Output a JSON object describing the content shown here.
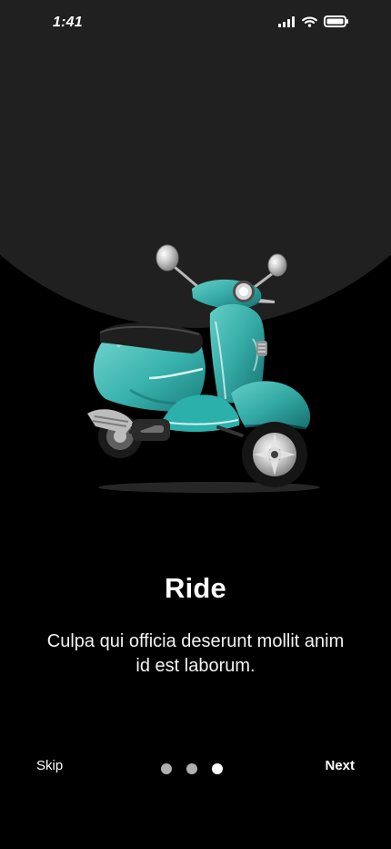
{
  "status_bar": {
    "time": "1:41",
    "icons": [
      "signal-icon",
      "wifi-icon",
      "battery-icon"
    ]
  },
  "hero": {
    "image_label": "scooter-image"
  },
  "content": {
    "title": "Ride",
    "description": "Culpa qui officia deserunt mollit anim id est laborum."
  },
  "navigation": {
    "skip_label": "Skip",
    "next_label": "Next",
    "page_count": 3,
    "active_page": 3
  },
  "colors": {
    "background": "#000000",
    "top_arc": "#202020",
    "text": "#FFFFFF",
    "dot_inactive": "#B0B0B0",
    "dot_active": "#FFFFFF",
    "scooter_body": "#43B8B3"
  }
}
